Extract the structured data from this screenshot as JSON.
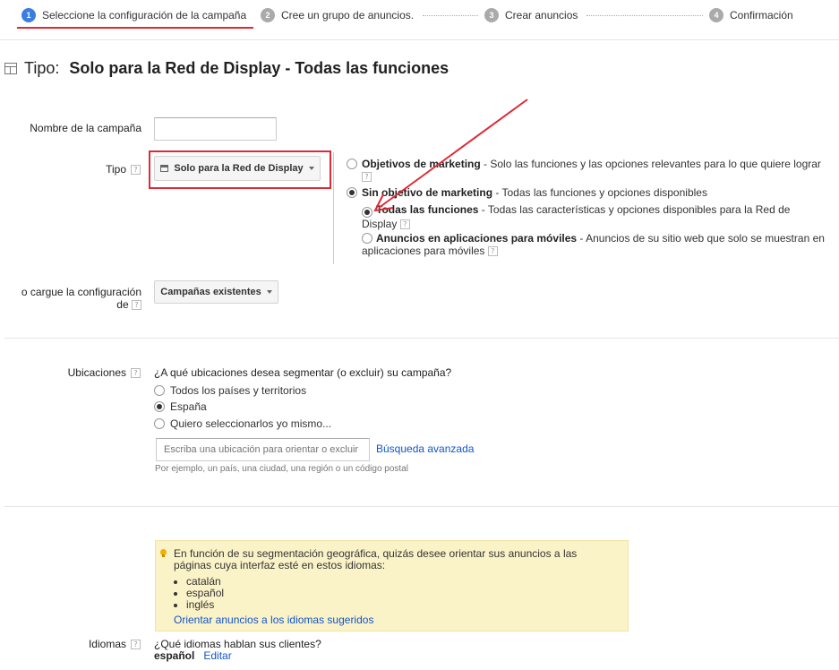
{
  "steps": [
    {
      "num": "1",
      "label": "Seleccione la configuración de la campaña"
    },
    {
      "num": "2",
      "label": "Cree un grupo de anuncios."
    },
    {
      "num": "3",
      "label": "Crear anuncios"
    },
    {
      "num": "4",
      "label": "Confirmación"
    }
  ],
  "header": {
    "prefix": "Tipo:",
    "title": "Solo para la Red de Display - Todas las funciones"
  },
  "campaign_name": {
    "label": "Nombre de la campaña",
    "value": ""
  },
  "tipo": {
    "label": "Tipo",
    "dropdown": "Solo para la Red de Display",
    "options": [
      {
        "bold": "Objetivos de marketing",
        "desc": " - Solo las funciones y las opciones relevantes para lo que quiere lograr"
      },
      {
        "bold": "Sin objetivo de marketing",
        "desc": " - Todas las funciones y opciones disponibles"
      }
    ],
    "suboptions": [
      {
        "bold": "Todas las funciones",
        "desc1": " - Todas las características y opciones disponibles para la Red de",
        "desc2": "Display"
      },
      {
        "bold": "Anuncios en aplicaciones para móviles",
        "desc1": " - Anuncios de su sitio web que solo se muestran en",
        "desc2": "aplicaciones para móviles"
      }
    ]
  },
  "load_settings": {
    "label1": "o cargue la configuración",
    "label2": "de",
    "button": "Campañas existentes"
  },
  "locations": {
    "label": "Ubicaciones",
    "question": "¿A qué ubicaciones desea segmentar (o excluir) su campaña?",
    "options": [
      "Todos los países y territorios",
      "España",
      "Quiero seleccionarlos yo mismo..."
    ],
    "search_placeholder": "Escriba una ubicación para orientar o excluir",
    "advanced_link": "Búsqueda avanzada",
    "hint": "Por ejemplo, un país, una ciudad, una región o un código postal"
  },
  "tip": {
    "text1": "En función de su segmentación geográfica, quizás desee orientar sus anuncios a las",
    "text2": "páginas cuya interfaz esté en estos idiomas:",
    "languages": [
      "catalán",
      "español",
      "inglés"
    ],
    "link": "Orientar anuncios a los idiomas sugeridos"
  },
  "languages": {
    "label": "Idiomas",
    "question": "¿Qué idiomas hablan sus clientes?",
    "value": "español",
    "edit": "Editar"
  },
  "help_glyph": "?",
  "colors": {
    "accent": "#3b7de0",
    "annotation": "#dd2b36",
    "tip_bg": "#fbf3c8",
    "link": "#1155cc"
  }
}
